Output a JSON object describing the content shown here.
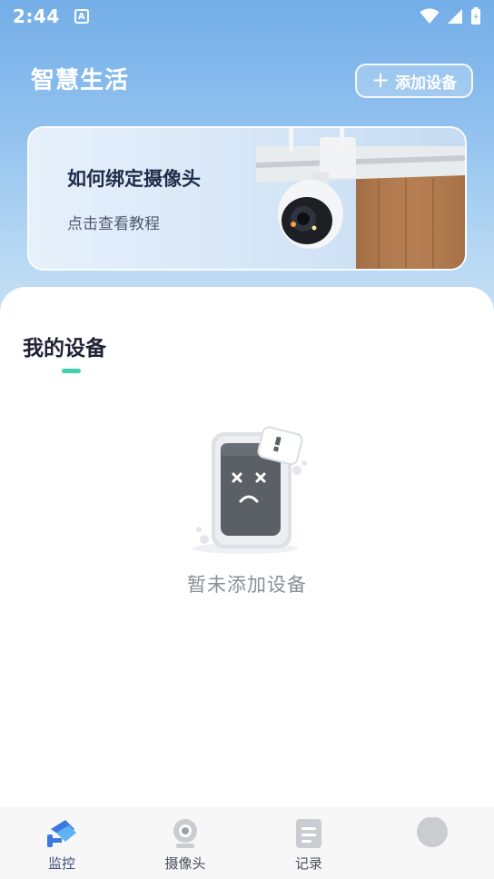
{
  "status_bar": {
    "time": "2:44",
    "notification_badge": "A"
  },
  "header": {
    "title": "智慧生活",
    "add_device_label": "添加设备"
  },
  "banner": {
    "title": "如何绑定摄像头",
    "subtitle": "点击查看教程"
  },
  "devices": {
    "section_title": "我的设备",
    "empty_text": "暂未添加设备"
  },
  "bottom_nav": {
    "items": [
      {
        "label": "监控",
        "icon": "monitor-camera-icon",
        "active": true
      },
      {
        "label": "摄像头",
        "icon": "webcam-icon",
        "active": false
      },
      {
        "label": "记录",
        "icon": "document-icon",
        "active": false
      },
      {
        "label": "",
        "icon": "profile-avatar-icon",
        "active": false
      }
    ]
  },
  "colors": {
    "accent": "#3fd0b0",
    "header_gradient_top": "#74aee8",
    "title_text": "#1e2233"
  }
}
